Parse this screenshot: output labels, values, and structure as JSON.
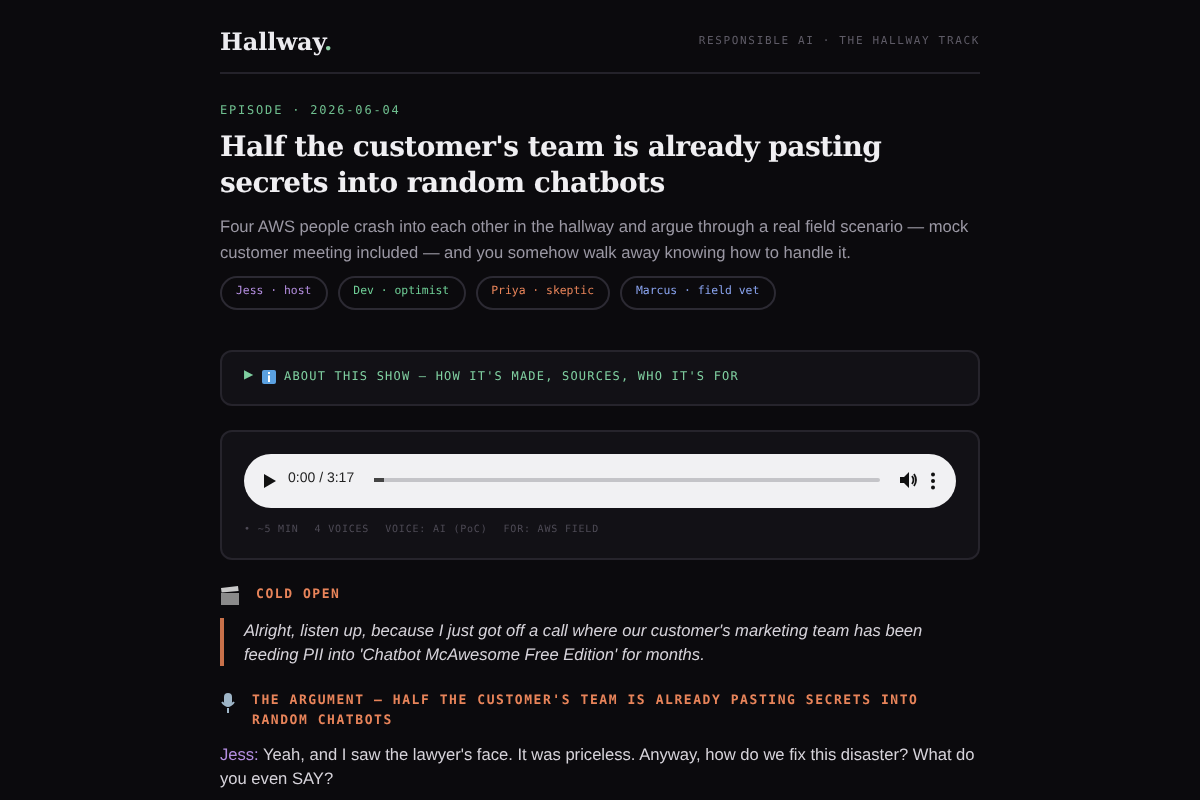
{
  "brand": {
    "name": "Hallway",
    "dot": "."
  },
  "header_tagline": "RESPONSIBLE AI · THE HALLWAY TRACK",
  "episode_label": "EPISODE · 2026-06-04",
  "title": "Half the customer's team is already pasting secrets into random chatbots",
  "description": "Four AWS people crash into each other in the hallway and argue through a real field scenario — mock customer meeting included — and you somehow walk away knowing how to handle it.",
  "cast_tags": [
    {
      "label": "Jess · host",
      "color": "#b48ee0"
    },
    {
      "label": "Dev · optimist",
      "color": "#6fcf97"
    },
    {
      "label": "Priya · skeptic",
      "color": "#e8845a"
    },
    {
      "label": "Marcus · field vet",
      "color": "#8aa4f0"
    }
  ],
  "about": {
    "marker": "▶",
    "label": "ABOUT THIS SHOW — HOW IT'S MADE, SOURCES, WHO IT'S FOR",
    "expanded": false
  },
  "player": {
    "time": "0:00 / 3:17",
    "level": 0.02
  },
  "meta": [
    "• ~5 MIN",
    "4 VOICES",
    "VOICE: AI (PoC)",
    "FOR: AWS FIELD"
  ],
  "sections": [
    {
      "kind": "quote",
      "heading": "COLD OPEN",
      "text": "Alright, listen up, because I just got off a call where our customer's marketing team has been feeding PII into 'Chatbot McAwesome Free Edition' for months."
    },
    {
      "kind": "dialogue",
      "heading": "THE ARGUMENT — HALF THE CUSTOMER'S TEAM IS ALREADY PASTING SECRETS INTO RANDOM CHATBOTS",
      "lines": [
        {
          "speaker": "Jess:",
          "color": "#b48ee0",
          "text": "Yeah, and I saw the lawyer's face. It was priceless. Anyway, how do we fix this disaster? What do you even SAY?"
        }
      ]
    }
  ]
}
